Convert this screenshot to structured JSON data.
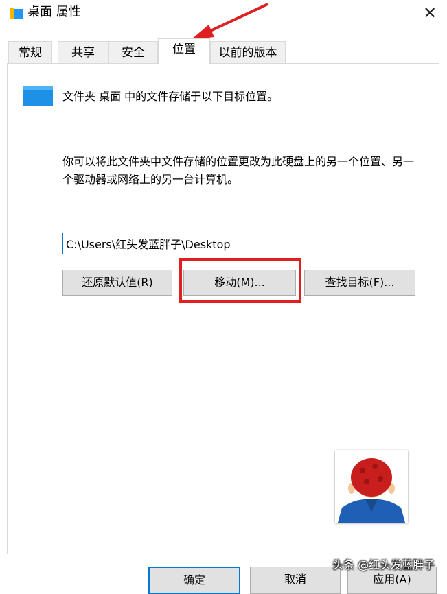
{
  "window": {
    "title": "桌面 属性",
    "close_glyph": "✕"
  },
  "tabs": [
    {
      "label": "常规",
      "active": false
    },
    {
      "label": "共享",
      "active": false
    },
    {
      "label": "安全",
      "active": false
    },
    {
      "label": "位置",
      "active": true
    },
    {
      "label": "以前的版本",
      "active": false
    }
  ],
  "location": {
    "info": "文件夹 桌面 中的文件存储于以下目标位置。",
    "description": "你可以将此文件夹中文件存储的位置更改为此硬盘上的另一个位置、另一个驱动器或网络上的另一台计算机。",
    "path_value": "C:\\Users\\红头发蓝胖子\\Desktop",
    "buttons": {
      "restore": "还原默认值(R)",
      "move": "移动(M)...",
      "find_target": "查找目标(F)..."
    }
  },
  "footer": {
    "ok": "确定",
    "cancel": "取消",
    "apply": "应用(A)"
  },
  "watermark": "头条 @红头发蓝胖子",
  "icons": {
    "title": "folder-icon",
    "folder": "folder-icon",
    "close": "close-icon"
  },
  "colors": {
    "accent": "#0078d7",
    "annotation_red": "#e02020",
    "button_bg": "#e1e1e1"
  }
}
